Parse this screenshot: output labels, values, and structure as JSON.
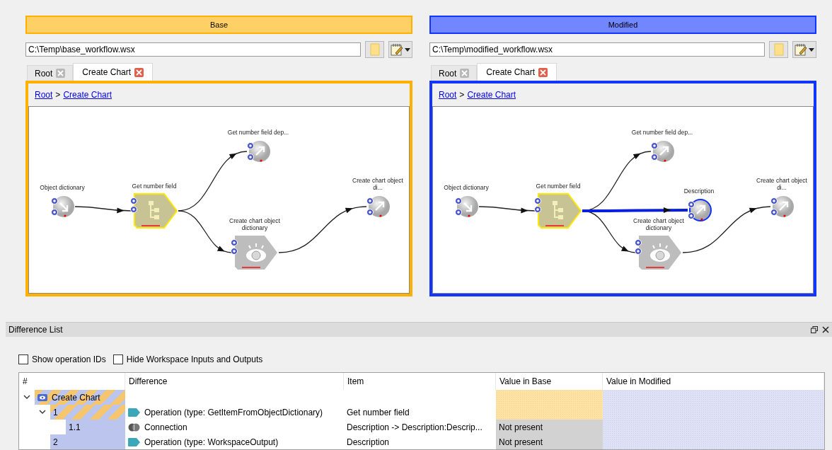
{
  "panes": [
    {
      "color": "#ffb000",
      "header": "Base",
      "path": "C:\\Temp\\base_workflow.wsx",
      "tabs": [
        {
          "label": "Root",
          "selected": false
        },
        {
          "label": "Create Chart",
          "selected": true
        }
      ],
      "breadcrumb": {
        "links": [
          "Root",
          "Create Chart"
        ],
        "separator": ">"
      },
      "nodes": [
        {
          "kind": "input",
          "label": "Object dictionary"
        },
        {
          "kind": "tree",
          "label": "Get number field",
          "changed": true
        },
        {
          "kind": "output",
          "label": "Get number field dep..."
        },
        {
          "kind": "eye",
          "label": "Create chart object dictionary"
        },
        {
          "kind": "output",
          "label": "Create chart object di..."
        }
      ]
    },
    {
      "color": "#1236ff",
      "header": "Modified",
      "path": "C:\\Temp\\modified_workflow.wsx",
      "tabs": [
        {
          "label": "Root",
          "selected": false
        },
        {
          "label": "Create Chart",
          "selected": true
        }
      ],
      "breadcrumb": {
        "links": [
          "Root",
          "Create Chart"
        ],
        "separator": ">"
      },
      "nodes": [
        {
          "kind": "input",
          "label": "Object dictionary"
        },
        {
          "kind": "tree",
          "label": "Get number field",
          "changed": true
        },
        {
          "kind": "output",
          "label": "Get number field dep..."
        },
        {
          "kind": "eye",
          "label": "Create chart object dictionary"
        },
        {
          "kind": "output",
          "label": "Create chart object di..."
        },
        {
          "kind": "output",
          "label": "Description",
          "added": true
        }
      ]
    }
  ],
  "diff_list": {
    "title": "Difference List",
    "options": [
      {
        "label": "Show operation IDs",
        "checked": false
      },
      {
        "label": "Hide Workspace Inputs and Outputs",
        "checked": false
      }
    ],
    "columns": [
      "#",
      "Difference",
      "Item",
      "Value in Base",
      "Value in Modified"
    ],
    "rows": [
      {
        "number": "Create Chart",
        "kind": "group",
        "changed": true,
        "expanded": true,
        "children": [
          {
            "number": "1",
            "kind": "operation",
            "changed": true,
            "difference": "Operation (type: GetItemFromObjectDictionary)",
            "item": "Get number field",
            "expanded": true,
            "children": [
              {
                "number": "1.1",
                "kind": "connection",
                "changed": false,
                "difference": "Connection",
                "item": "Description -> Description:Descrip...",
                "value_in_base": "Not present"
              }
            ]
          },
          {
            "number": "2",
            "kind": "operation",
            "changed": false,
            "difference": "Operation (type: WorkspaceOutput)",
            "item": "Description",
            "value_in_base": "Not present"
          }
        ]
      }
    ]
  }
}
